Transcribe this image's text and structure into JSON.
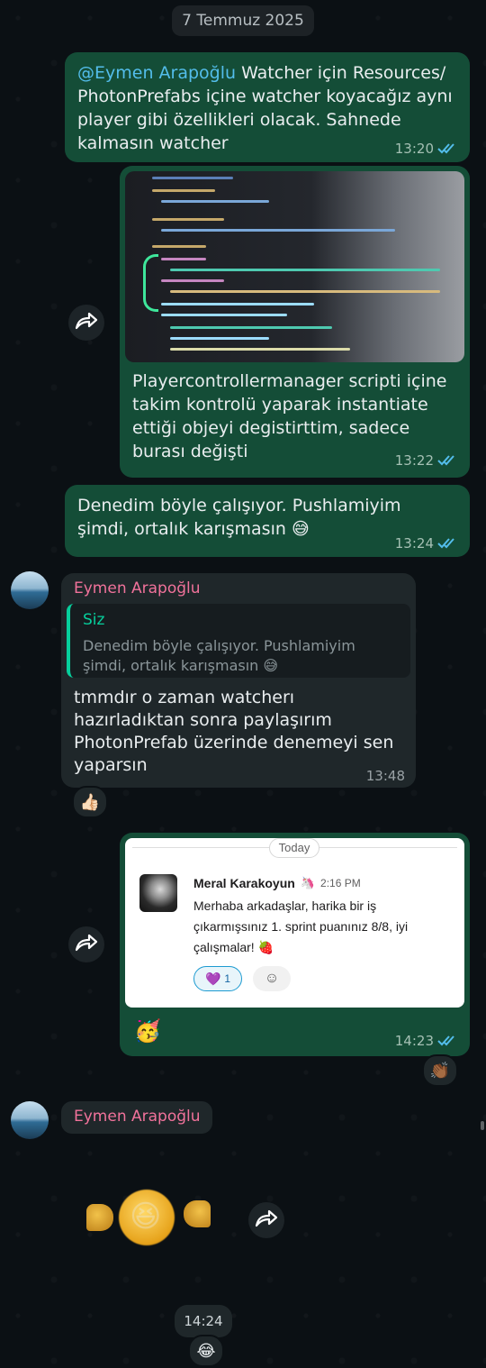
{
  "date_separator": "7 Temmuz 2025",
  "messages": [
    {
      "mention": "@Eymen Arapoğlu",
      "text": " Watcher için Resources/ PhotonPrefabs içine watcher koyacağız aynı player gibi özellikleri olacak. Sahnede kalmasın watcher",
      "time": "13:20"
    },
    {
      "caption": "Playercontrollermanager scripti içine takim kontrolü yaparak instantiate ettiği objeyi degistirttim, sadece burası değişti",
      "time": "13:22"
    },
    {
      "text": "Denedim böyle çalışıyor. Pushlamiyim şimdi, ortalık karışmasın 😅",
      "time": "13:24"
    },
    {
      "sender": "Eymen Arapoğlu",
      "reply_author": "Siz",
      "reply_text": "Denedim böyle çalışıyor. Pushlamiyim şimdi, ortalık karışmasın 😅",
      "text": "tmmdır o zaman watcherı hazırladıktan sonra paylaşırım PhotonPrefab üzerinde denemeyi sen yaparsın",
      "time": "13:48",
      "reaction": "👍🏻"
    },
    {
      "slack": {
        "divider_label": "Today",
        "author": "Meral Karakoyun",
        "author_badge": "🦄",
        "time": "2:16 PM",
        "text": "Merhaba arkadaşlar, harika bir iş çıkarmışsınız 1. sprint puanınız 8/8, iyi çalışmalar! 🍓",
        "reaction_emoji": "💜",
        "reaction_count": "1",
        "add_reaction_icon": "☺"
      },
      "emoji_caption": "🥳",
      "time": "14:23",
      "reaction": "👏🏾"
    },
    {
      "sender": "Eymen Arapoğlu",
      "sticker": "😆",
      "time": "14:24",
      "reaction": "😂"
    }
  ],
  "colors": {
    "outgoing": "#144d37",
    "incoming": "#1f272a",
    "sender": "#f1729b",
    "mention": "#53bdeb",
    "read_ticks": "#53bdeb"
  }
}
